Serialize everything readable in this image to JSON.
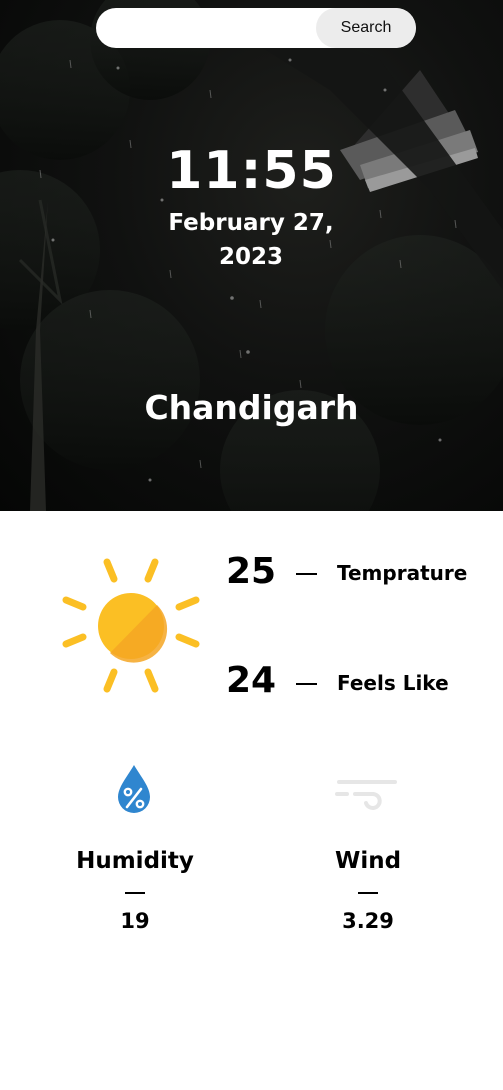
{
  "search": {
    "value": "",
    "placeholder": "",
    "button_label": "Search"
  },
  "header": {
    "time": "11:55",
    "date_line1": "February 27,",
    "date_line2": "2023",
    "city": "Chandigarh"
  },
  "current": {
    "icon": "sun-icon",
    "temperature_value": "25",
    "temperature_label": "Temprature",
    "feels_like_value": "24",
    "feels_like_label": "Feels Like"
  },
  "details": {
    "humidity": {
      "icon": "humidity-drop-icon",
      "label": "Humidity",
      "value": "19"
    },
    "wind": {
      "icon": "wind-icon",
      "label": "Wind",
      "value": "3.29"
    }
  },
  "colors": {
    "sun": "#FBBF24",
    "sun_shade": "#F5A623",
    "drop": "#2F86CF",
    "wind_icon": "#E6E6E6",
    "search_button": "#ECECEC"
  }
}
